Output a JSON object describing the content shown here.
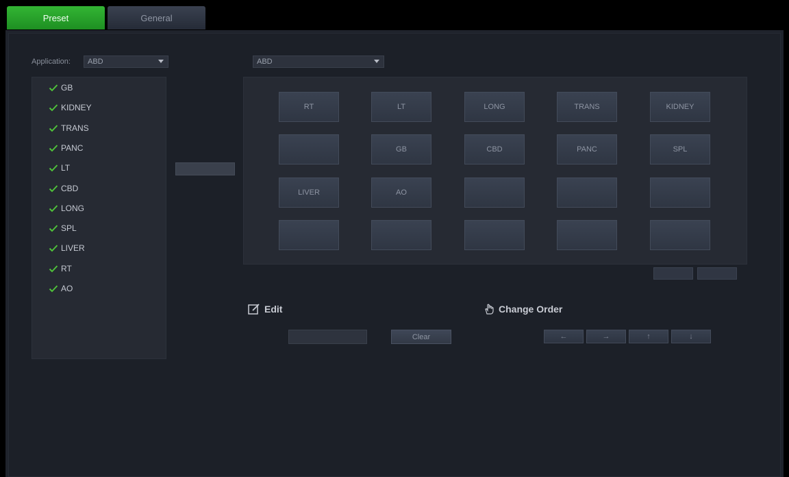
{
  "tabs": [
    {
      "label": "Preset",
      "active": true
    },
    {
      "label": "General",
      "active": false
    }
  ],
  "application": {
    "label": "Application:",
    "value": "ABD"
  },
  "exam_list": [
    "GB",
    "KIDNEY",
    "TRANS",
    "PANC",
    "LT",
    "CBD",
    "LONG",
    "SPL",
    "LIVER",
    "RT",
    "AO"
  ],
  "view_select": {
    "value": "ABD"
  },
  "grid": [
    [
      "RT",
      "LT",
      "LONG",
      "TRANS",
      "KIDNEY"
    ],
    [
      "",
      "GB",
      "CBD",
      "PANC",
      "SPL"
    ],
    [
      "LIVER",
      "AO",
      "",
      "",
      ""
    ],
    [
      "",
      "",
      "",
      "",
      ""
    ]
  ],
  "edit": {
    "title": "Edit",
    "input_value": "",
    "clear_label": "Clear"
  },
  "change_order": {
    "title": "Change Order",
    "buttons": [
      "←",
      "→",
      "↑",
      "↓"
    ]
  },
  "colors": {
    "active_tab": "#2aa52d",
    "check": "#4fc23a",
    "background": "#1c2028"
  }
}
